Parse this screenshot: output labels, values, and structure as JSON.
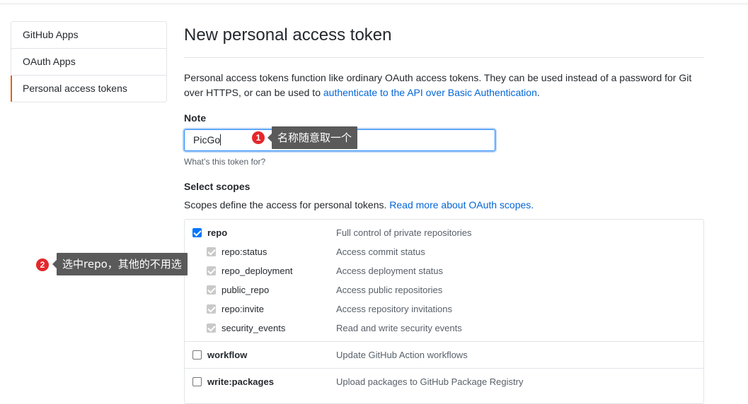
{
  "sidebar": {
    "items": [
      {
        "label": "GitHub Apps"
      },
      {
        "label": "OAuth Apps"
      },
      {
        "label": "Personal access tokens"
      }
    ]
  },
  "main": {
    "title": "New personal access token",
    "intro_text": "Personal access tokens function like ordinary OAuth access tokens. They can be used instead of a password for Git over HTTPS, or can be used to ",
    "intro_link": "authenticate to the API over Basic Authentication",
    "intro_end": ".",
    "note_label": "Note",
    "note_value": "PicGo",
    "note_hint": "What’s this token for?",
    "scopes_label": "Select scopes",
    "scopes_desc": "Scopes define the access for personal tokens. ",
    "scopes_link": "Read more about OAuth scopes."
  },
  "scopes": [
    {
      "name": "repo",
      "desc": "Full control of private repositories",
      "state": "checked"
    },
    {
      "name": "repo:status",
      "desc": "Access commit status",
      "state": "checked-disabled"
    },
    {
      "name": "repo_deployment",
      "desc": "Access deployment status",
      "state": "checked-disabled"
    },
    {
      "name": "public_repo",
      "desc": "Access public repositories",
      "state": "checked-disabled"
    },
    {
      "name": "repo:invite",
      "desc": "Access repository invitations",
      "state": "checked-disabled"
    },
    {
      "name": "security_events",
      "desc": "Read and write security events",
      "state": "checked-disabled"
    },
    {
      "name": "workflow",
      "desc": "Update GitHub Action workflows",
      "state": "unchecked"
    },
    {
      "name": "write:packages",
      "desc": "Upload packages to GitHub Package Registry",
      "state": "unchecked"
    }
  ],
  "annotations": {
    "one_number": "1",
    "one_text": "名称随意取一个",
    "two_number": "2",
    "two_text": "选中repo，其他的不用选"
  },
  "colors": {
    "link": "#0366d6",
    "selected_accent": "#e36209",
    "badge": "#e5272b",
    "tooltip": "#5a5a5a"
  }
}
